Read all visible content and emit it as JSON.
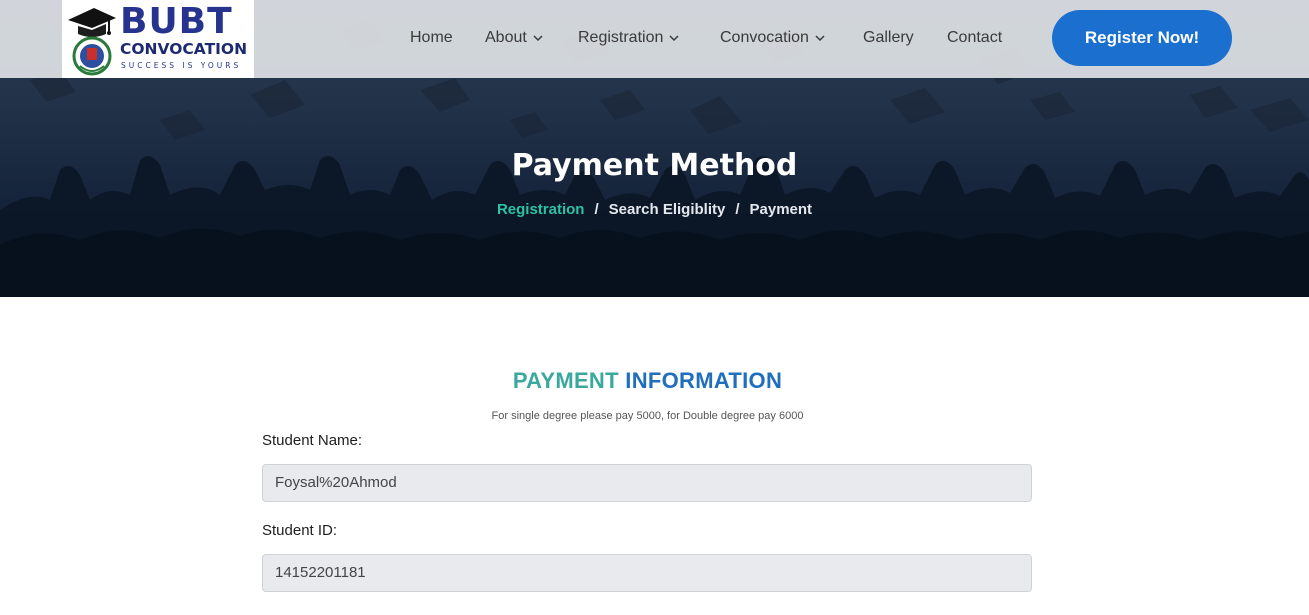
{
  "header": {
    "logo": {
      "word": "BUBT",
      "sub": "CONVOCATION",
      "tagline": "SUCCESS IS YOURS"
    },
    "nav": [
      {
        "label": "Home",
        "has_dropdown": false
      },
      {
        "label": "About",
        "has_dropdown": true
      },
      {
        "label": "Registration",
        "has_dropdown": true
      },
      {
        "label": "Convocation",
        "has_dropdown": true
      },
      {
        "label": "Gallery",
        "has_dropdown": false
      },
      {
        "label": "Contact",
        "has_dropdown": false
      }
    ],
    "cta_label": "Register Now!"
  },
  "hero": {
    "title": "Payment Method",
    "breadcrumb": [
      "Registration",
      "Search Eligiblity",
      "Payment"
    ],
    "separator": "/"
  },
  "form": {
    "heading_part1": "PAYMENT",
    "heading_part2": "INFORMATION",
    "note": "For single degree please pay 5000, for Double degree pay 6000",
    "fields": [
      {
        "label": "Student Name:",
        "value": "Foysal%20Ahmod"
      },
      {
        "label": "Student ID:",
        "value": "14152201181"
      }
    ]
  },
  "colors": {
    "accent_blue": "#1b6fcf",
    "teal": "#3aa89c",
    "breadcrumb_link": "#2ec1a4",
    "logo_navy": "#26348f"
  }
}
